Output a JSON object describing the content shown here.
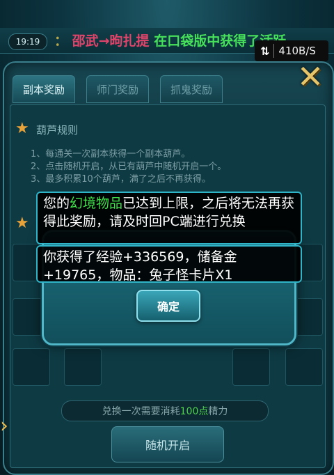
{
  "status_bar": {
    "time": "19:19",
    "net_speed": "410B/S"
  },
  "marquee": {
    "colon": "：",
    "player": "邵武→昫扎提",
    "text": "在口袋版中获得了活跃"
  },
  "tabs": [
    {
      "label": "副本奖励",
      "active": true
    },
    {
      "label": "师门奖励",
      "active": false
    },
    {
      "label": "抓鬼奖励",
      "active": false
    }
  ],
  "rules": {
    "title": "葫芦规则",
    "items": [
      "1、每通关一次副本获得一个副本葫芦。",
      "2、点击随机开启，从已有葫芦中随机开启一个。",
      "3、最多积累10个葫芦，满了之后不再获得。"
    ]
  },
  "cost": {
    "prefix": "兑换一次需要消耗",
    "amount": "100点",
    "suffix": "精力"
  },
  "random_button": "随机开启",
  "dialog": {
    "confirm": "确定"
  },
  "toasts": {
    "limit_pre": "您的",
    "limit_hl": "幻境物品",
    "limit_post": "已达到上限，之后将无法再获得此奖励，请及时回PC端进行兑换",
    "reward": "你获得了经验+336569，储备金+19765，物品：兔子怪卡片X1"
  }
}
